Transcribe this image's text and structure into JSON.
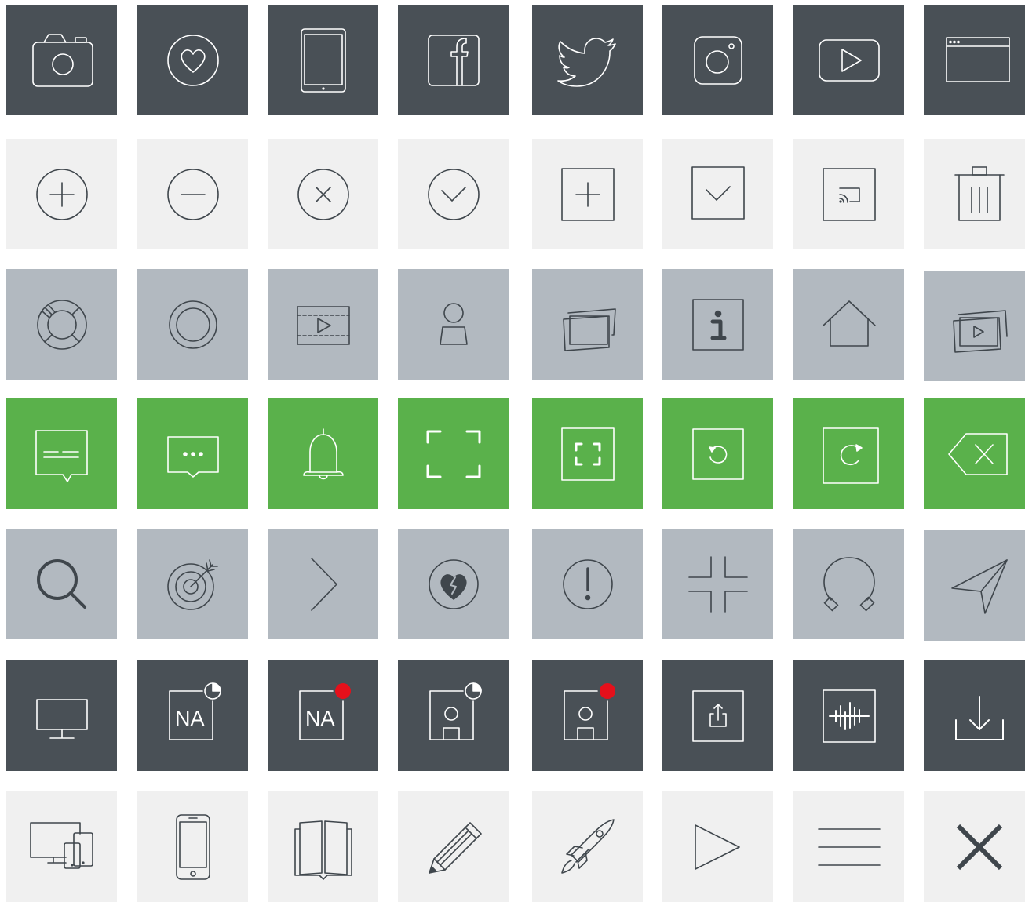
{
  "colors": {
    "dark": "#495056",
    "light": "#f0f0f0",
    "gray": "#b2b9c0",
    "green": "#5ab14b",
    "badge_red": "#e5101b"
  },
  "rows": [
    [
      "camera",
      "heart-circle",
      "tablet",
      "facebook",
      "twitter",
      "instagram",
      "youtube",
      "browser-window"
    ],
    [
      "plus-circle",
      "minus-circle",
      "close-circle",
      "check-circle",
      "plus-square",
      "check-square",
      "cast",
      "trash"
    ],
    [
      "lifebuoy",
      "record",
      "video-film",
      "user",
      "photos",
      "info",
      "home",
      "video-gallery"
    ],
    [
      "comment",
      "chat-dots",
      "bell",
      "fullscreen",
      "fullscreen-boxed",
      "rotate-left",
      "rotate-right",
      "backspace"
    ],
    [
      "search",
      "target",
      "chevron-right",
      "broken-heart",
      "alert",
      "exit-fullscreen",
      "headphones",
      "send"
    ],
    [
      "monitor",
      "na-pie",
      "na-dot",
      "user-pie",
      "user-dot",
      "share",
      "audio-waveform",
      "download"
    ],
    [
      "devices",
      "smartphone",
      "book",
      "pencil",
      "rocket",
      "play",
      "menu",
      "close"
    ]
  ],
  "na_label": "NA"
}
